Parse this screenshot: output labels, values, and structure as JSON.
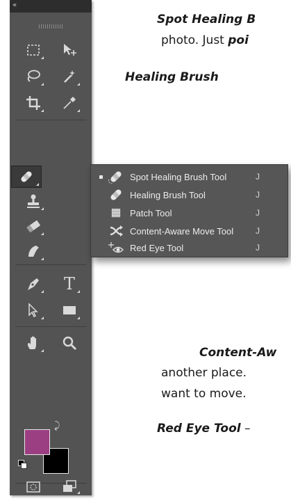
{
  "document": {
    "p1_term": "Spot Healing B",
    "p2_text": "photo. Just ",
    "p2_em": "poi",
    "p3_term": "Healing Brush",
    "p4_term": "Content-Aw",
    "p5_text": "another place.",
    "p6_text": "want to move.",
    "p7_term": "Red Eye Tool",
    "p7_text": " –"
  },
  "toolbox": {
    "collapse_glyph": "«",
    "colors": {
      "foreground": "#9c3f82",
      "background": "#000000",
      "panel": "#535353"
    },
    "tools": [
      {
        "name": "rectangular-marquee",
        "icon": "marquee-icon"
      },
      {
        "name": "move",
        "icon": "move-icon"
      },
      {
        "name": "lasso",
        "icon": "lasso-icon"
      },
      {
        "name": "magic-wand",
        "icon": "magic-wand-icon"
      },
      {
        "name": "crop",
        "icon": "crop-icon"
      },
      {
        "name": "eyedropper",
        "icon": "eyedropper-icon"
      },
      {
        "name": "spot-healing-brush",
        "icon": "bandage-icon",
        "active": true
      },
      {
        "name": "clone-stamp",
        "icon": "stamp-icon"
      },
      {
        "name": "eraser",
        "icon": "eraser-icon"
      },
      {
        "name": "smudge",
        "icon": "smudge-icon"
      },
      {
        "name": "pen",
        "icon": "pen-icon"
      },
      {
        "name": "type",
        "icon": "type-icon",
        "glyph": "T"
      },
      {
        "name": "path-selection",
        "icon": "arrow-icon"
      },
      {
        "name": "rectangle",
        "icon": "rectangle-icon"
      },
      {
        "name": "hand",
        "icon": "hand-icon"
      },
      {
        "name": "zoom",
        "icon": "zoom-icon"
      },
      {
        "name": "quick-mask",
        "icon": "quick-mask-icon"
      },
      {
        "name": "screen-mode",
        "icon": "screen-mode-icon"
      }
    ]
  },
  "flyout": {
    "items": [
      {
        "label": "Spot Healing Brush Tool",
        "shortcut": "J",
        "icon": "spot-healing-icon",
        "selected": true
      },
      {
        "label": "Healing Brush Tool",
        "shortcut": "J",
        "icon": "healing-brush-icon",
        "selected": false
      },
      {
        "label": "Patch Tool",
        "shortcut": "J",
        "icon": "patch-icon",
        "selected": false
      },
      {
        "label": "Content-Aware Move Tool",
        "shortcut": "J",
        "icon": "content-aware-move-icon",
        "selected": false
      },
      {
        "label": "Red Eye Tool",
        "shortcut": "J",
        "icon": "red-eye-icon",
        "selected": false
      }
    ]
  }
}
